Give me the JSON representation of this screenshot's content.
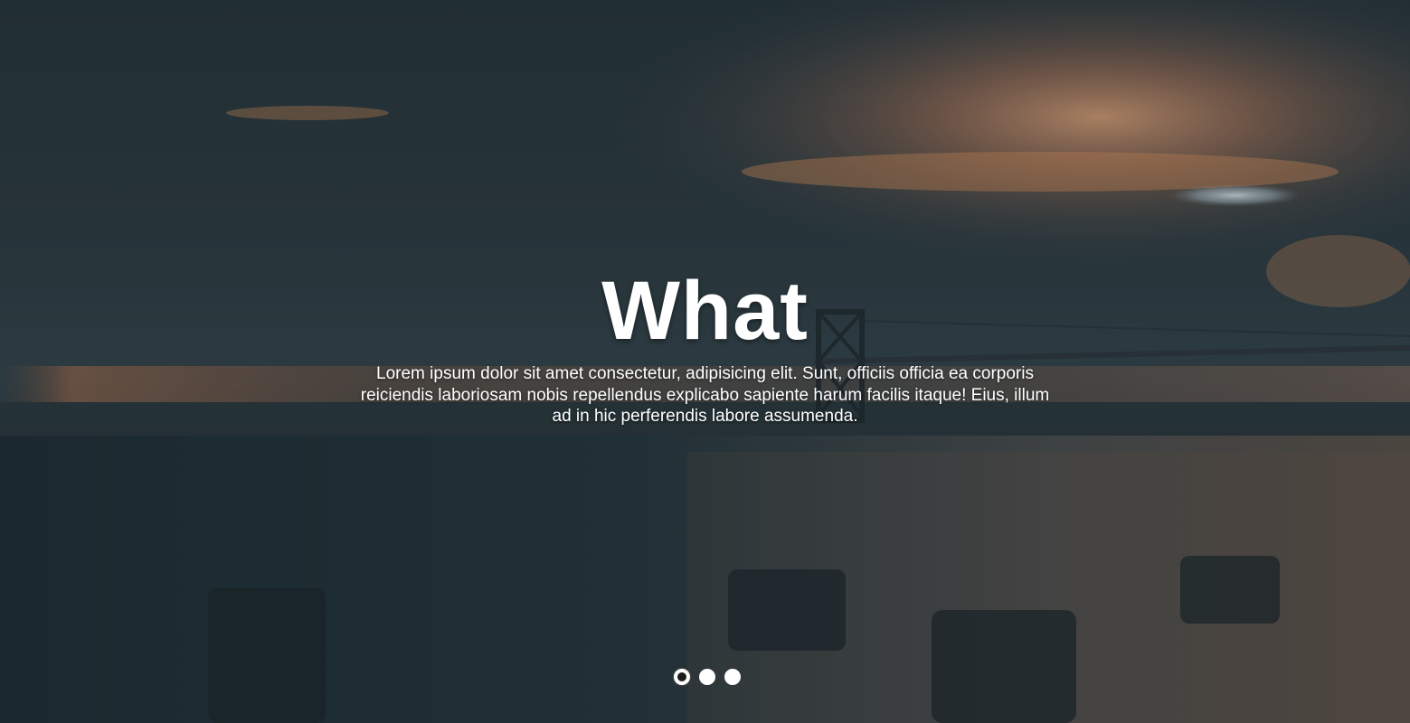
{
  "slider": {
    "title": "What",
    "description": "Lorem ipsum dolor sit amet consectetur, adipisicing elit. Sunt, officiis officia ea corporis reiciendis laboriosam nobis repellendus explicabo sapiente harum facilis itaque! Eius, illum ad in hic perferendis labore assumenda.",
    "active_slide": 1,
    "total_slides": 3
  },
  "colors": {
    "text": "#ffffff",
    "active_dot": "#1b1b1b",
    "inactive_dot": "#ffffff"
  }
}
